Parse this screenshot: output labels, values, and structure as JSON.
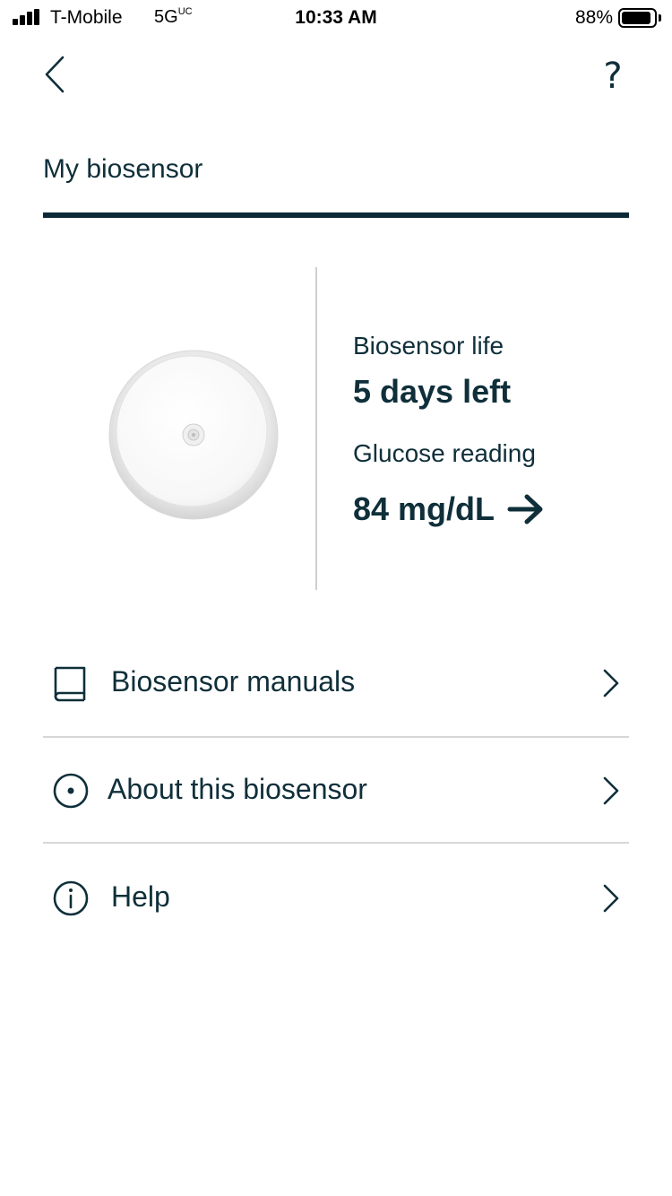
{
  "status_bar": {
    "carrier": "T-Mobile",
    "network": "5G",
    "network_suffix": "UC",
    "time": "10:33 AM",
    "battery_percent": "88%"
  },
  "header": {
    "help_label": "?"
  },
  "tab": {
    "title": "My biosensor"
  },
  "sensor": {
    "life_label": "Biosensor life",
    "life_value": "5 days left",
    "glucose_label": "Glucose reading",
    "glucose_value": "84 mg/dL"
  },
  "menu": {
    "items": [
      {
        "label": "Biosensor manuals",
        "icon": "book-icon"
      },
      {
        "label": "About this biosensor",
        "icon": "sensor-circle-icon"
      },
      {
        "label": "Help",
        "icon": "info-icon"
      }
    ]
  },
  "colors": {
    "text": "#0f2f3a",
    "underline": "#0b2a36",
    "divider": "#d7d7d7"
  }
}
